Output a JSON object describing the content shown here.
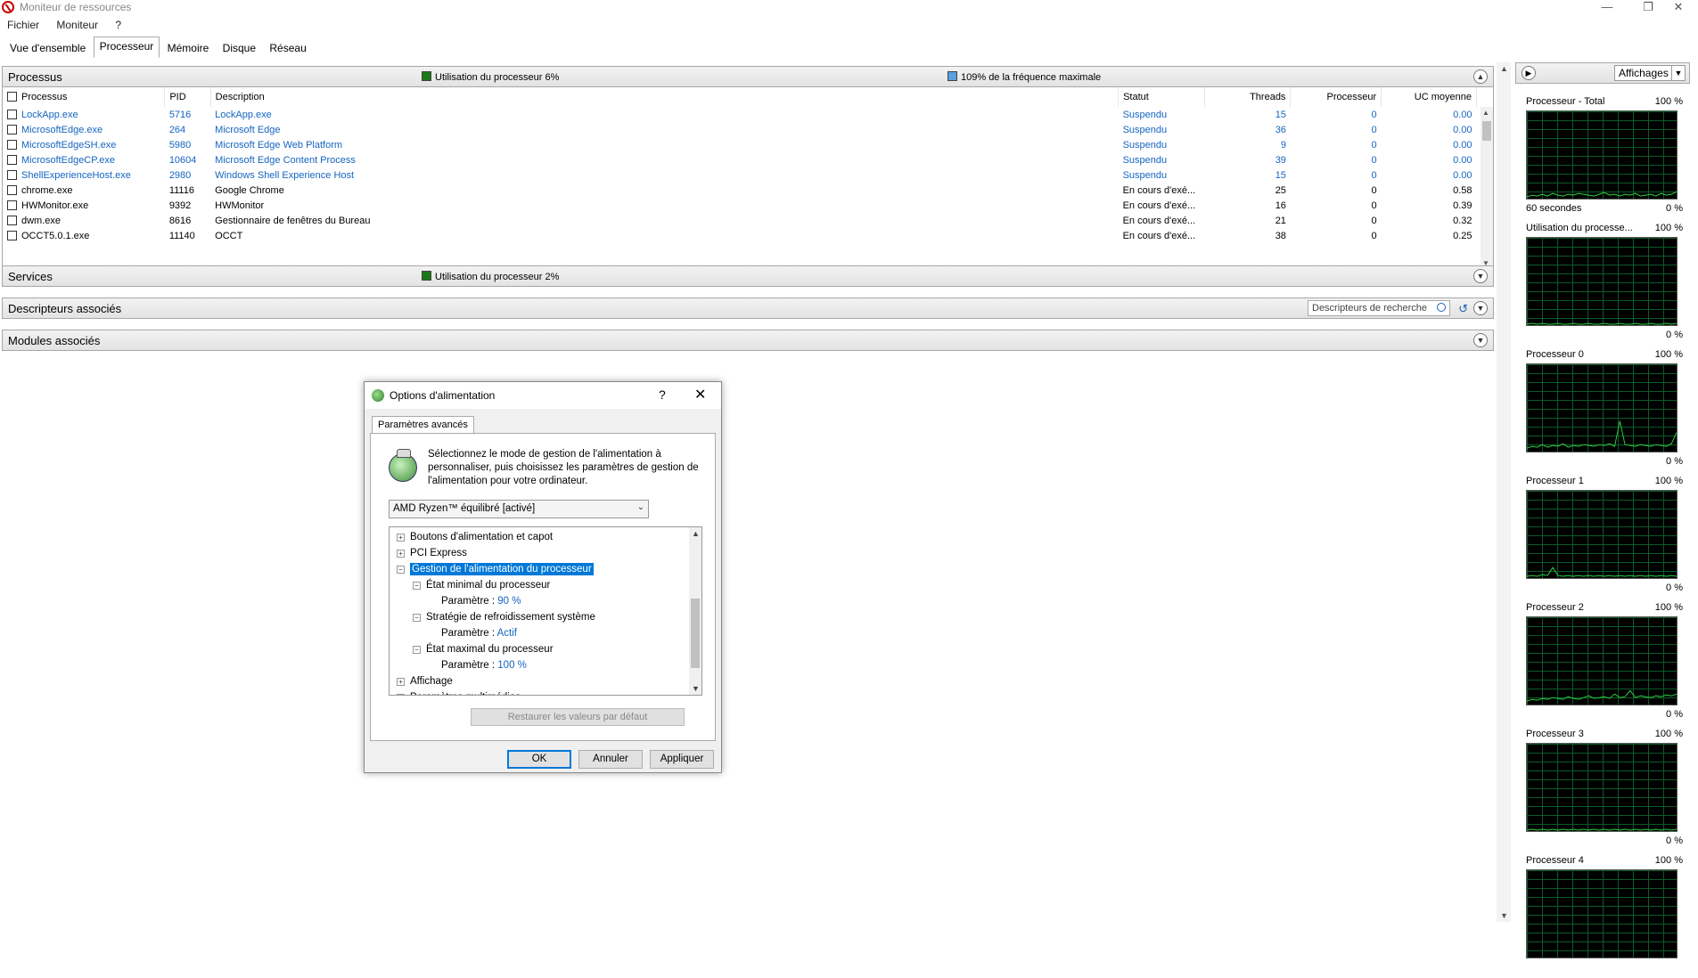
{
  "window": {
    "title": "Moniteur de ressources"
  },
  "menu": [
    "Fichier",
    "Moniteur",
    "?"
  ],
  "tabs": [
    {
      "label": "Vue d'ensemble",
      "active": false
    },
    {
      "label": "Processeur",
      "active": true
    },
    {
      "label": "Mémoire",
      "active": false
    },
    {
      "label": "Disque",
      "active": false
    },
    {
      "label": "Réseau",
      "active": false
    }
  ],
  "processes": {
    "title": "Processus",
    "cpu_usage_legend": "Utilisation du processeur 6%",
    "freq_legend": "109% de la fréquence maximale",
    "columns": [
      "Processus",
      "PID",
      "Description",
      "Statut",
      "Threads",
      "Processeur",
      "UC moyenne"
    ],
    "rows": [
      {
        "name": "LockApp.exe",
        "pid": "5716",
        "desc": "LockApp.exe",
        "status": "Suspendu",
        "threads": "15",
        "cpu": "0",
        "avg": "0.00",
        "suspended": true
      },
      {
        "name": "MicrosoftEdge.exe",
        "pid": "264",
        "desc": "Microsoft Edge",
        "status": "Suspendu",
        "threads": "36",
        "cpu": "0",
        "avg": "0.00",
        "suspended": true
      },
      {
        "name": "MicrosoftEdgeSH.exe",
        "pid": "5980",
        "desc": "Microsoft Edge Web Platform",
        "status": "Suspendu",
        "threads": "9",
        "cpu": "0",
        "avg": "0.00",
        "suspended": true
      },
      {
        "name": "MicrosoftEdgeCP.exe",
        "pid": "10604",
        "desc": "Microsoft Edge Content Process",
        "status": "Suspendu",
        "threads": "39",
        "cpu": "0",
        "avg": "0.00",
        "suspended": true
      },
      {
        "name": "ShellExperienceHost.exe",
        "pid": "2980",
        "desc": "Windows Shell Experience Host",
        "status": "Suspendu",
        "threads": "15",
        "cpu": "0",
        "avg": "0.00",
        "suspended": true
      },
      {
        "name": "chrome.exe",
        "pid": "11116",
        "desc": "Google Chrome",
        "status": "En cours d'exé...",
        "threads": "25",
        "cpu": "0",
        "avg": "0.58",
        "suspended": false
      },
      {
        "name": "HWMonitor.exe",
        "pid": "9392",
        "desc": "HWMonitor",
        "status": "En cours d'exé...",
        "threads": "16",
        "cpu": "0",
        "avg": "0.39",
        "suspended": false
      },
      {
        "name": "dwm.exe",
        "pid": "8616",
        "desc": "Gestionnaire de fenêtres du Bureau",
        "status": "En cours d'exé...",
        "threads": "21",
        "cpu": "0",
        "avg": "0.32",
        "suspended": false
      },
      {
        "name": "OCCT5.0.1.exe",
        "pid": "11140",
        "desc": "OCCT",
        "status": "En cours d'exé...",
        "threads": "38",
        "cpu": "0",
        "avg": "0.25",
        "suspended": false
      }
    ]
  },
  "services": {
    "title": "Services",
    "cpu_usage_legend": "Utilisation du processeur 2%"
  },
  "handles": {
    "title": "Descripteurs associés",
    "search_placeholder": "Descripteurs de recherche"
  },
  "modules": {
    "title": "Modules associés"
  },
  "right_panel": {
    "views_label": "Affichages",
    "graphs": [
      {
        "title": "Processeur - Total",
        "max": "100 %",
        "min": "0 %",
        "sub": "60 secondes",
        "points": [
          0.02,
          0.04,
          0.03,
          0.05,
          0.03,
          0.06,
          0.04,
          0.03,
          0.05,
          0.04,
          0.06,
          0.05,
          0.04,
          0.03,
          0.05,
          0.07,
          0.04,
          0.05,
          0.03,
          0.05,
          0.04,
          0.06,
          0.03,
          0.04,
          0.05,
          0.03,
          0.06,
          0.04,
          0.05,
          0.08
        ]
      },
      {
        "title": "Utilisation du processe...",
        "max": "100 %",
        "min": "0 %",
        "sub": "",
        "points": [
          0.01,
          0.02,
          0.01,
          0.02,
          0.01,
          0.01,
          0.02,
          0.01,
          0.01,
          0.02,
          0.01,
          0.01,
          0.02,
          0.01,
          0.01,
          0.02,
          0.01,
          0.01,
          0.02,
          0.01,
          0.01,
          0.02,
          0.01,
          0.01,
          0.02,
          0.01,
          0.01,
          0.02,
          0.01,
          0.02
        ]
      },
      {
        "title": "Processeur 0",
        "max": "100 %",
        "min": "0 %",
        "sub": "",
        "points": [
          0.04,
          0.06,
          0.05,
          0.08,
          0.05,
          0.07,
          0.06,
          0.09,
          0.05,
          0.07,
          0.06,
          0.08,
          0.07,
          0.06,
          0.08,
          0.07,
          0.09,
          0.06,
          0.35,
          0.08,
          0.07,
          0.06,
          0.08,
          0.07,
          0.06,
          0.08,
          0.07,
          0.06,
          0.09,
          0.22
        ]
      },
      {
        "title": "Processeur 1",
        "max": "100 %",
        "min": "0 %",
        "sub": "",
        "points": [
          0.02,
          0.03,
          0.02,
          0.04,
          0.03,
          0.12,
          0.03,
          0.02,
          0.03,
          0.02,
          0.03,
          0.02,
          0.03,
          0.02,
          0.03,
          0.02,
          0.03,
          0.02,
          0.03,
          0.02,
          0.03,
          0.02,
          0.03,
          0.02,
          0.03,
          0.02,
          0.03,
          0.02,
          0.03,
          0.02
        ]
      },
      {
        "title": "Processeur 2",
        "max": "100 %",
        "min": "0 %",
        "sub": "",
        "points": [
          0.04,
          0.06,
          0.05,
          0.07,
          0.06,
          0.08,
          0.07,
          0.06,
          0.09,
          0.07,
          0.06,
          0.08,
          0.1,
          0.07,
          0.08,
          0.09,
          0.07,
          0.12,
          0.08,
          0.09,
          0.16,
          0.08,
          0.1,
          0.09,
          0.08,
          0.1,
          0.09,
          0.11,
          0.1,
          0.12
        ]
      },
      {
        "title": "Processeur 3",
        "max": "100 %",
        "min": "0 %",
        "sub": "",
        "points": [
          0.01,
          0.02,
          0.01,
          0.02,
          0.01,
          0.02,
          0.01,
          0.02,
          0.01,
          0.02,
          0.01,
          0.02,
          0.01,
          0.02,
          0.01,
          0.02,
          0.01,
          0.02,
          0.01,
          0.02,
          0.01,
          0.02,
          0.01,
          0.02,
          0.01,
          0.02,
          0.01,
          0.02,
          0.01,
          0.02
        ]
      },
      {
        "title": "Processeur 4",
        "max": "100 %",
        "min": "",
        "sub": "",
        "points": []
      }
    ]
  },
  "dialog": {
    "title": "Options d'alimentation",
    "help": "?",
    "close": "✕",
    "tab": "Paramètres avancés",
    "description": "Sélectionnez le mode de gestion de l'alimentation à personnaliser, puis choisissez les paramètres de gestion de l'alimentation pour votre ordinateur.",
    "plan": "AMD Ryzen™ équilibré [activé]",
    "tree": [
      {
        "indent": 0,
        "toggle": "+",
        "label": "Boutons d'alimentation et capot",
        "selected": false,
        "value": ""
      },
      {
        "indent": 0,
        "toggle": "+",
        "label": "PCI Express",
        "selected": false,
        "value": ""
      },
      {
        "indent": 0,
        "toggle": "−",
        "label": "Gestion de l'alimentation du processeur",
        "selected": true,
        "value": ""
      },
      {
        "indent": 1,
        "toggle": "−",
        "label": "État minimal du processeur",
        "selected": false,
        "value": ""
      },
      {
        "indent": 2,
        "toggle": "",
        "label": "Paramètre :",
        "selected": false,
        "value": "90  %"
      },
      {
        "indent": 1,
        "toggle": "−",
        "label": "Stratégie de refroidissement système",
        "selected": false,
        "value": ""
      },
      {
        "indent": 2,
        "toggle": "",
        "label": "Paramètre :",
        "selected": false,
        "value": "Actif"
      },
      {
        "indent": 1,
        "toggle": "−",
        "label": "État maximal du processeur",
        "selected": false,
        "value": ""
      },
      {
        "indent": 2,
        "toggle": "",
        "label": "Paramètre :",
        "selected": false,
        "value": "100  %"
      },
      {
        "indent": 0,
        "toggle": "+",
        "label": "Affichage",
        "selected": false,
        "value": ""
      },
      {
        "indent": 0,
        "toggle": "+",
        "label": "Paramètres multimédias",
        "selected": false,
        "value": ""
      }
    ],
    "restore_label": "Restaurer les valeurs par défaut",
    "ok_label": "OK",
    "cancel_label": "Annuler",
    "apply_label": "Appliquer"
  },
  "colors": {
    "cpu_legend": "#1a7a1a",
    "freq_legend": "#5aa0e0",
    "graph_line": "#2ecc40",
    "suspended_text": "#1565c0",
    "selection": "#0078d7"
  }
}
